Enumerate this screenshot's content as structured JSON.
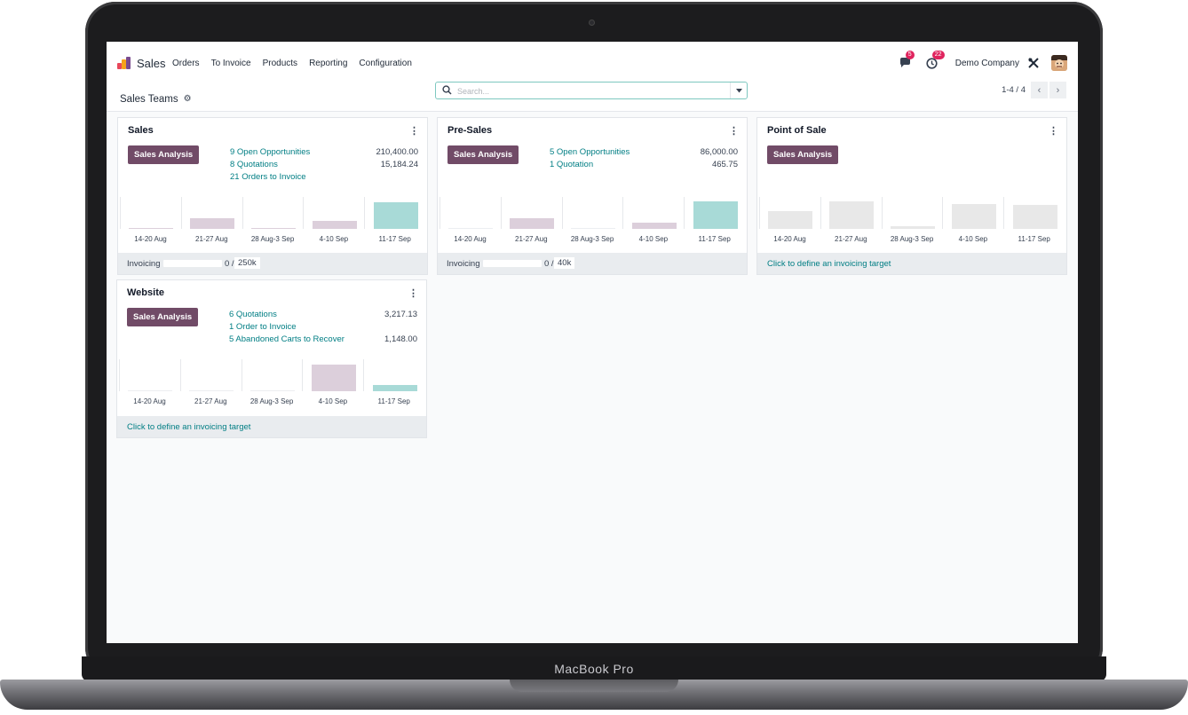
{
  "device": {
    "label": "MacBook Pro"
  },
  "app": {
    "name": "Sales",
    "menu": [
      "Orders",
      "To Invoice",
      "Products",
      "Reporting",
      "Configuration"
    ],
    "systray": {
      "messages_badge": "5",
      "activities_badge": "22",
      "company": "Demo Company"
    }
  },
  "controlbar": {
    "breadcrumb": "Sales Teams",
    "search_placeholder": "Search...",
    "pager": "1-4 / 4"
  },
  "colors": {
    "accent": "#714b67",
    "link": "#017e84",
    "bar_past": "#dccfdb",
    "bar_current": "#a8dad7",
    "bar_sample": "#e8e8e8"
  },
  "week_labels": [
    "14-20 Aug",
    "21-27 Aug",
    "28 Aug-3 Sep",
    "4-10 Sep",
    "11-17 Sep"
  ],
  "teams": [
    {
      "name": "Sales",
      "button": "Sales Analysis",
      "stats": [
        {
          "label": "9 Open Opportunities",
          "value": "210,400.00"
        },
        {
          "label": "8 Quotations",
          "value": "15,184.24"
        },
        {
          "label": "21 Orders to Invoice",
          "value": ""
        }
      ],
      "bars": [
        0.02,
        0.38,
        0.03,
        0.27,
        0.95
      ],
      "bar_style": "invoiced",
      "footer": {
        "type": "invoicing",
        "label": "Invoicing",
        "current": "0 /",
        "target": "250k",
        "progress": 0
      }
    },
    {
      "name": "Pre-Sales",
      "button": "Sales Analysis",
      "stats": [
        {
          "label": "5 Open Opportunities",
          "value": "86,000.00"
        },
        {
          "label": "1 Quotation",
          "value": "465.75"
        }
      ],
      "bars": [
        0.0,
        0.38,
        0.0,
        0.22,
        0.98
      ],
      "bar_style": "invoiced",
      "footer": {
        "type": "invoicing",
        "label": "Invoicing",
        "current": "0 /",
        "target": "40k",
        "progress": 0
      }
    },
    {
      "name": "Point of Sale",
      "button": "Sales Analysis",
      "stats": [],
      "bars": [
        0.62,
        0.98,
        0.1,
        0.88,
        0.84
      ],
      "bar_style": "sample",
      "footer": {
        "type": "link",
        "label": "Click to define an invoicing target"
      }
    },
    {
      "name": "Website",
      "button": "Sales Analysis",
      "stats": [
        {
          "label": "6 Quotations",
          "value": "3,217.13"
        },
        {
          "label": "1 Order to Invoice",
          "value": ""
        },
        {
          "label": "5  Abandoned Carts to Recover",
          "value": "1,148.00"
        }
      ],
      "bars": [
        0.0,
        0.0,
        0.0,
        0.95,
        0.22
      ],
      "bar_style": "invoiced",
      "footer": {
        "type": "link",
        "label": "Click to define an invoicing target"
      }
    }
  ]
}
